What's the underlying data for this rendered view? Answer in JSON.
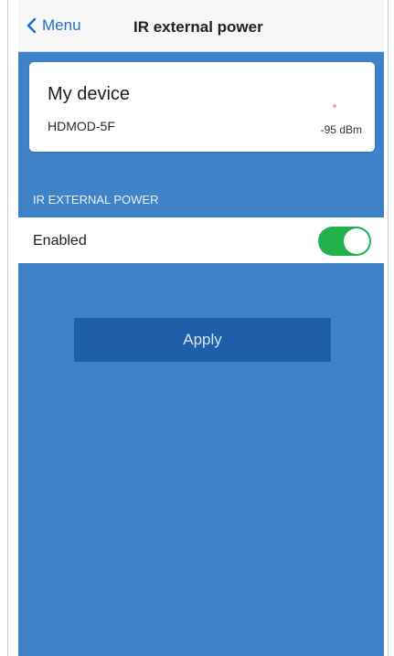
{
  "header": {
    "back_label": "Menu",
    "title": "IR external power"
  },
  "device": {
    "name": "My device",
    "id": "HDMOD-5F",
    "signal": "-95 dBm"
  },
  "section": {
    "label": "IR EXTERNAL POWER"
  },
  "setting": {
    "label": "Enabled",
    "enabled": true
  },
  "apply_label": "Apply",
  "colors": {
    "background": "#3f82c7",
    "toggle_on": "#22b24c",
    "button": "#1f5fa9",
    "link": "#1a73c9"
  },
  "icons": {
    "back": "chevron-left-icon"
  }
}
